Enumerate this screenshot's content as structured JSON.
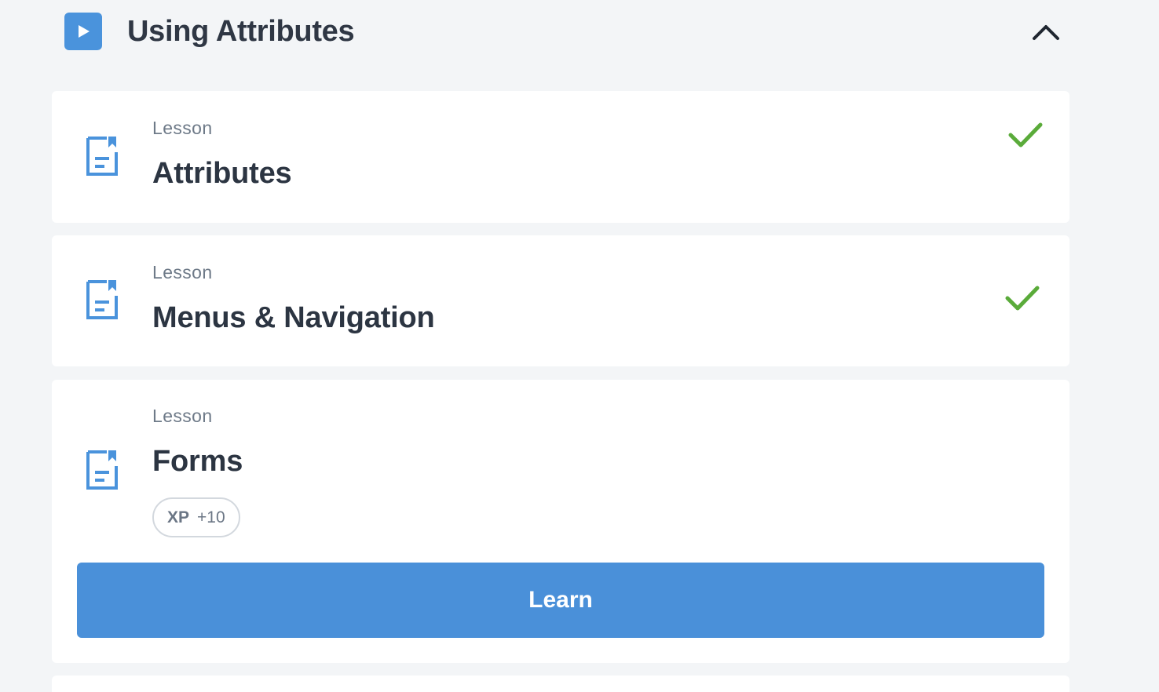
{
  "section": {
    "title": "Using Attributes",
    "icon": "play-icon",
    "toggle_icon": "chevron-up-icon",
    "accent_color": "#4a93dc"
  },
  "lessons": [
    {
      "kicker": "Lesson",
      "title": "Attributes",
      "icon": "document-icon",
      "status": "completed"
    },
    {
      "kicker": "Lesson",
      "title": "Menus & Navigation",
      "icon": "document-icon",
      "status": "completed"
    },
    {
      "kicker": "Lesson",
      "title": "Forms",
      "icon": "document-icon",
      "status": "current",
      "xp_label": "XP",
      "xp_value": "+10",
      "action_label": "Learn"
    }
  ],
  "colors": {
    "check": "#5aab3a",
    "button": "#4a90d9",
    "background": "#f3f5f7"
  }
}
